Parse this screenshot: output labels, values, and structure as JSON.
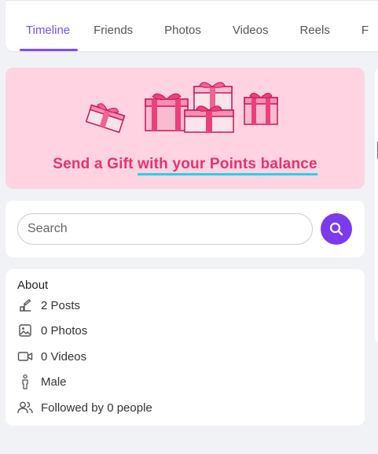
{
  "tabs": [
    {
      "label": "Timeline",
      "active": true
    },
    {
      "label": "Friends"
    },
    {
      "label": "Photos"
    },
    {
      "label": "Videos"
    },
    {
      "label": "Reels"
    },
    {
      "label": "F"
    }
  ],
  "banner": {
    "text_plain": "Send a Gift ",
    "text_underlined": "with your Points balance"
  },
  "search": {
    "placeholder": "Search",
    "value": ""
  },
  "about": {
    "title": "About",
    "items": [
      {
        "icon": "posts-icon",
        "text": "2 Posts"
      },
      {
        "icon": "image-icon",
        "text": "0 Photos"
      },
      {
        "icon": "video-icon",
        "text": "0 Videos"
      },
      {
        "icon": "male-icon",
        "text": "Male"
      },
      {
        "icon": "followers-icon",
        "text": "Followed by 0 people"
      }
    ]
  },
  "colors": {
    "accent": "#7c4dff",
    "banner_bg": "#ffd3e1",
    "banner_text": "#e4346e",
    "underline": "#22d3ee",
    "search_button": "#7c3aed"
  }
}
